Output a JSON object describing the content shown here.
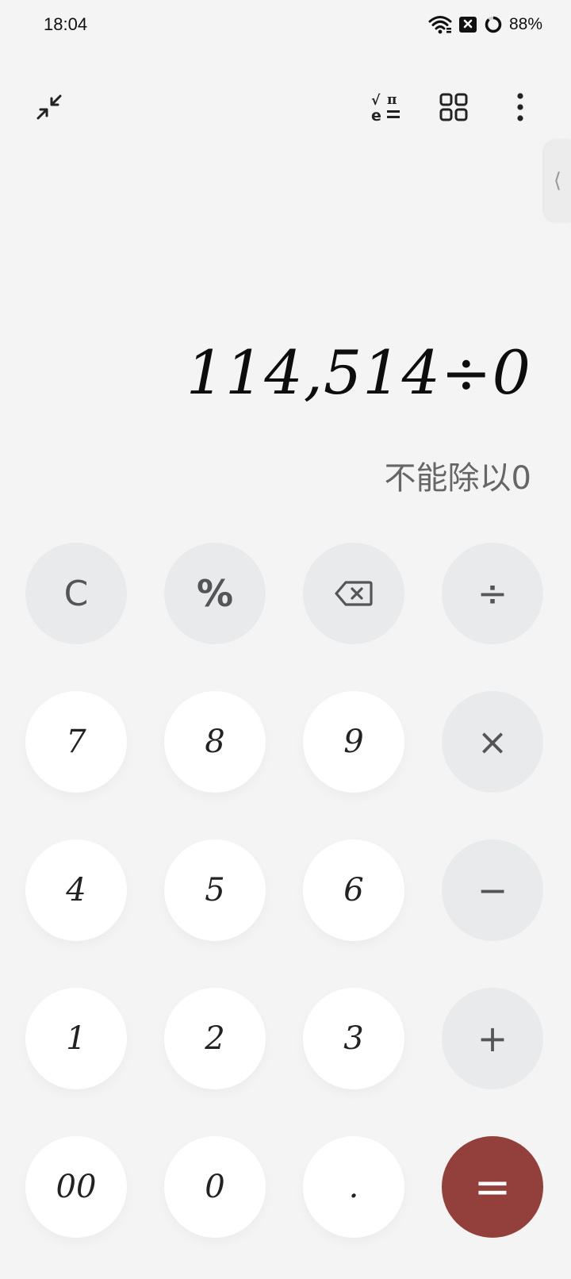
{
  "status": {
    "time": "18:04",
    "battery": "88%",
    "icons": [
      "wifi-icon",
      "sim-no-signal-icon",
      "battery-ring-icon"
    ]
  },
  "toolbar": {
    "icons": [
      "collapse-icon",
      "scientific-mode-icon",
      "grid-icon",
      "more-options-icon"
    ]
  },
  "side_handle": {
    "glyph": "⟨"
  },
  "display": {
    "expression": "114,514÷0",
    "result": "不能除以0"
  },
  "keys": {
    "clear": "C",
    "percent": "%",
    "divide": "÷",
    "seven": "7",
    "eight": "8",
    "nine": "9",
    "multiply": "×",
    "four": "4",
    "five": "5",
    "six": "6",
    "minus": "−",
    "one": "1",
    "two": "2",
    "three": "3",
    "plus": "+",
    "double_zero": "00",
    "zero": "0",
    "decimal": ".",
    "equals": "="
  },
  "colors": {
    "background": "#f4f4f4",
    "number_key": "#ffffff",
    "operator_key": "#e9eaec",
    "equals_key": "#93403c"
  }
}
